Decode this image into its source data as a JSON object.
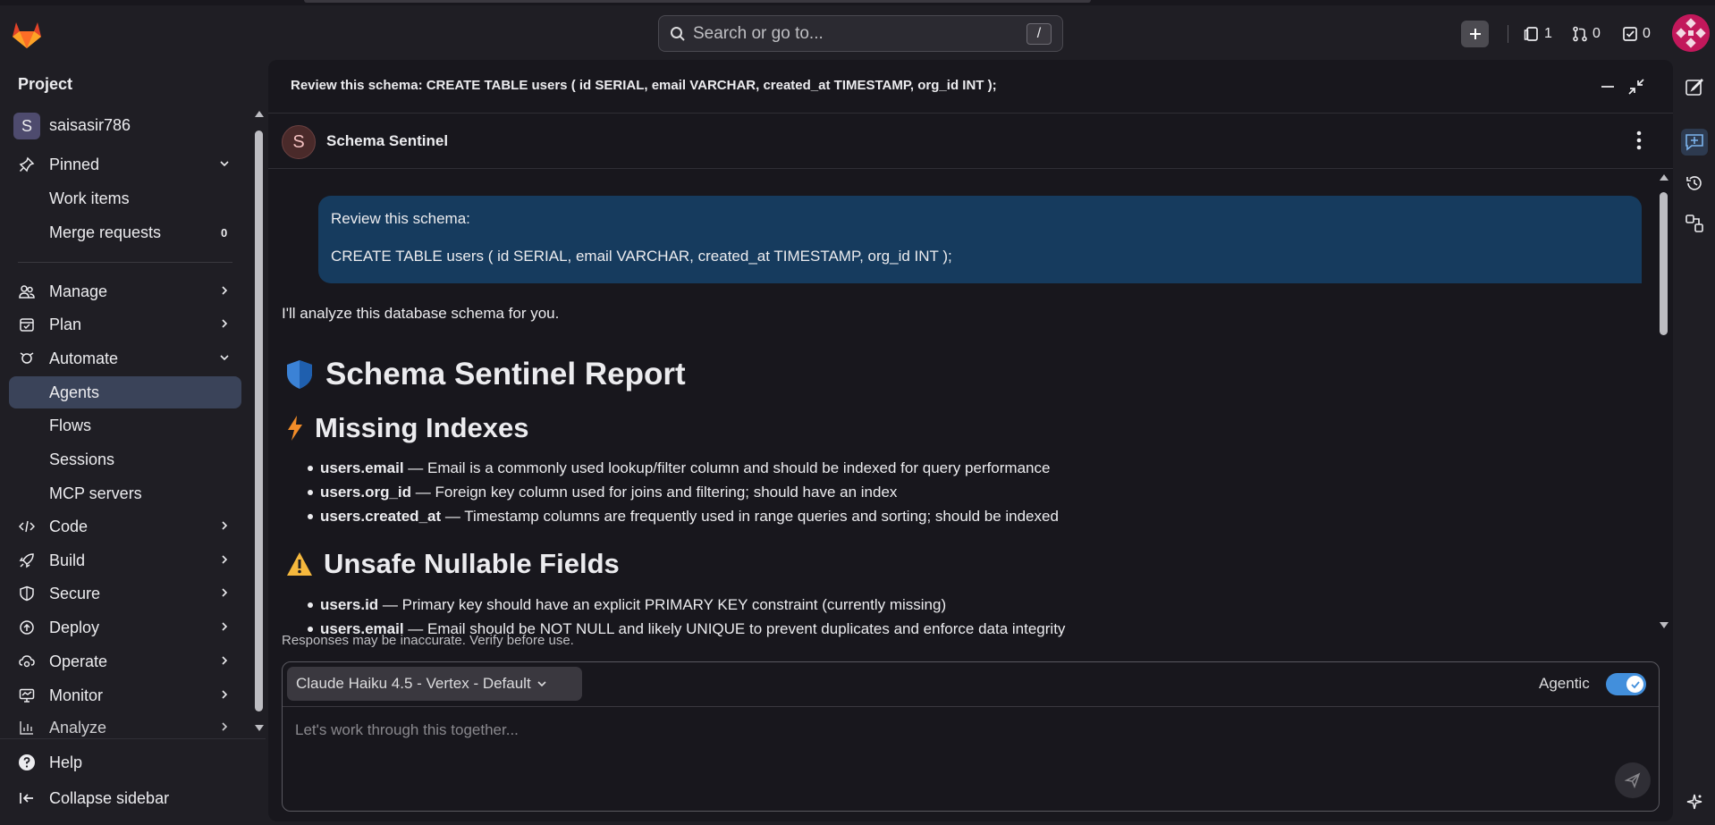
{
  "search": {
    "placeholder": "Search or go to...",
    "shortcut": "/"
  },
  "header": {
    "issues_count": "1",
    "merge_requests_count": "0",
    "todos_count": "0"
  },
  "sidebar": {
    "section_title": "Project",
    "project_name": "saisasir786",
    "project_initial": "S",
    "pinned": "Pinned",
    "pinned_items": [
      {
        "label": "Work items"
      },
      {
        "label": "Merge requests",
        "count": "0"
      }
    ],
    "nav": [
      {
        "label": "Manage"
      },
      {
        "label": "Plan"
      },
      {
        "label": "Automate"
      },
      {
        "label": "Agents"
      },
      {
        "label": "Flows"
      },
      {
        "label": "Sessions"
      },
      {
        "label": "MCP servers"
      },
      {
        "label": "Code"
      },
      {
        "label": "Build"
      },
      {
        "label": "Secure"
      },
      {
        "label": "Deploy"
      },
      {
        "label": "Operate"
      },
      {
        "label": "Monitor"
      },
      {
        "label": "Analyze"
      }
    ],
    "help": "Help",
    "collapse": "Collapse sidebar"
  },
  "panel": {
    "title": "Review this schema: CREATE TABLE users ( id SERIAL, email VARCHAR, created_at TIMESTAMP, org_id INT );",
    "agent_initial": "S",
    "agent_name": "Schema Sentinel"
  },
  "chat": {
    "user_line1": "Review this schema:",
    "user_line2": "CREATE TABLE users ( id SERIAL, email VARCHAR, created_at TIMESTAMP, org_id INT );",
    "intro": "I'll analyze this database schema for you.",
    "report_title": "Schema Sentinel Report",
    "missing_indexes_title": "Missing Indexes",
    "missing_indexes": [
      {
        "field": "users.email",
        "text": " — Email is a commonly used lookup/filter column and should be indexed for query performance"
      },
      {
        "field": "users.org_id",
        "text": " — Foreign key column used for joins and filtering; should have an index"
      },
      {
        "field": "users.created_at",
        "text": " — Timestamp columns are frequently used in range queries and sorting; should be indexed"
      }
    ],
    "nullable_title": "Unsafe Nullable Fields",
    "nullable": [
      {
        "field": "users.id",
        "text": " — Primary key should have an explicit PRIMARY KEY constraint (currently missing)"
      },
      {
        "field": "users.email",
        "text": " — Email should be NOT NULL and likely UNIQUE to prevent duplicates and enforce data integrity"
      }
    ]
  },
  "composer": {
    "disclaimer": "Responses may be inaccurate. Verify before use.",
    "model": "Claude Haiku 4.5 - Vertex - Default",
    "agentic_label": "Agentic",
    "agentic_on": true,
    "placeholder": "Let's work through this together..."
  },
  "colors": {
    "accent": "#428fdc",
    "user_bubble": "#163b5e",
    "active_nav": "#3a4359"
  }
}
